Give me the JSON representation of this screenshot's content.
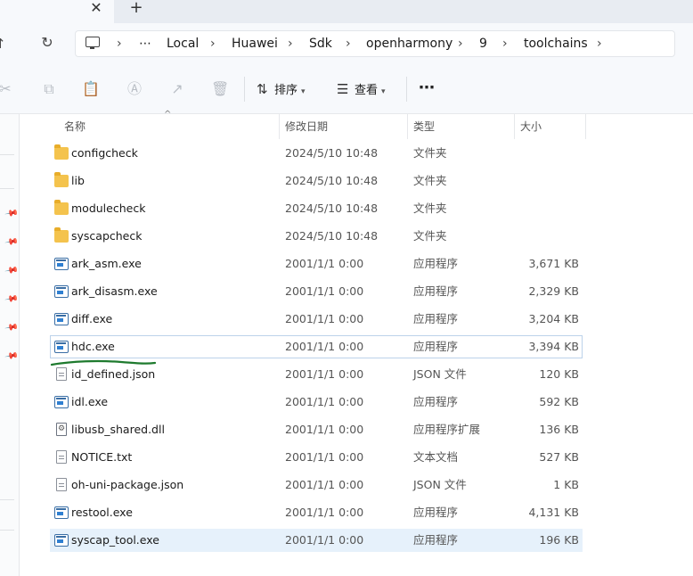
{
  "tabs": {
    "close_glyph": "✕",
    "new_glyph": "+"
  },
  "nav": {
    "up_glyph": "↑",
    "refresh_glyph": "↻"
  },
  "breadcrumb": {
    "sep": "›",
    "more": "⋯",
    "items": [
      "Local",
      "Huawei",
      "Sdk",
      "openharmony",
      "9",
      "toolchains"
    ]
  },
  "toolbar": {
    "sort_label": "排序",
    "view_label": "查看",
    "more_glyph": "⋯",
    "icons": [
      "cut-icon",
      "copy-icon",
      "paste-icon",
      "rename-icon",
      "share-icon",
      "delete-icon"
    ]
  },
  "columns": {
    "name": "名称",
    "date": "修改日期",
    "type": "类型",
    "size": "大小"
  },
  "files": [
    {
      "name": "configcheck",
      "date": "2024/5/10 10:48",
      "type": "文件夹",
      "size": "",
      "icon": "folder"
    },
    {
      "name": "lib",
      "date": "2024/5/10 10:48",
      "type": "文件夹",
      "size": "",
      "icon": "folder"
    },
    {
      "name": "modulecheck",
      "date": "2024/5/10 10:48",
      "type": "文件夹",
      "size": "",
      "icon": "folder"
    },
    {
      "name": "syscapcheck",
      "date": "2024/5/10 10:48",
      "type": "文件夹",
      "size": "",
      "icon": "folder"
    },
    {
      "name": "ark_asm.exe",
      "date": "2001/1/1 0:00",
      "type": "应用程序",
      "size": "3,671 KB",
      "icon": "exe"
    },
    {
      "name": "ark_disasm.exe",
      "date": "2001/1/1 0:00",
      "type": "应用程序",
      "size": "2,329 KB",
      "icon": "exe"
    },
    {
      "name": "diff.exe",
      "date": "2001/1/1 0:00",
      "type": "应用程序",
      "size": "3,204 KB",
      "icon": "exe"
    },
    {
      "name": "hdc.exe",
      "date": "2001/1/1 0:00",
      "type": "应用程序",
      "size": "3,394 KB",
      "icon": "exe",
      "state": "focused"
    },
    {
      "name": "id_defined.json",
      "date": "2001/1/1 0:00",
      "type": "JSON 文件",
      "size": "120 KB",
      "icon": "doc"
    },
    {
      "name": "idl.exe",
      "date": "2001/1/1 0:00",
      "type": "应用程序",
      "size": "592 KB",
      "icon": "exe"
    },
    {
      "name": "libusb_shared.dll",
      "date": "2001/1/1 0:00",
      "type": "应用程序扩展",
      "size": "136 KB",
      "icon": "dll"
    },
    {
      "name": "NOTICE.txt",
      "date": "2001/1/1 0:00",
      "type": "文本文档",
      "size": "527 KB",
      "icon": "doc"
    },
    {
      "name": "oh-uni-package.json",
      "date": "2001/1/1 0:00",
      "type": "JSON 文件",
      "size": "1 KB",
      "icon": "doc"
    },
    {
      "name": "restool.exe",
      "date": "2001/1/1 0:00",
      "type": "应用程序",
      "size": "4,131 KB",
      "icon": "exe"
    },
    {
      "name": "syscap_tool.exe",
      "date": "2001/1/1 0:00",
      "type": "应用程序",
      "size": "196 KB",
      "icon": "exe",
      "state": "selected"
    }
  ],
  "annotation_color": "#1e7a2e"
}
